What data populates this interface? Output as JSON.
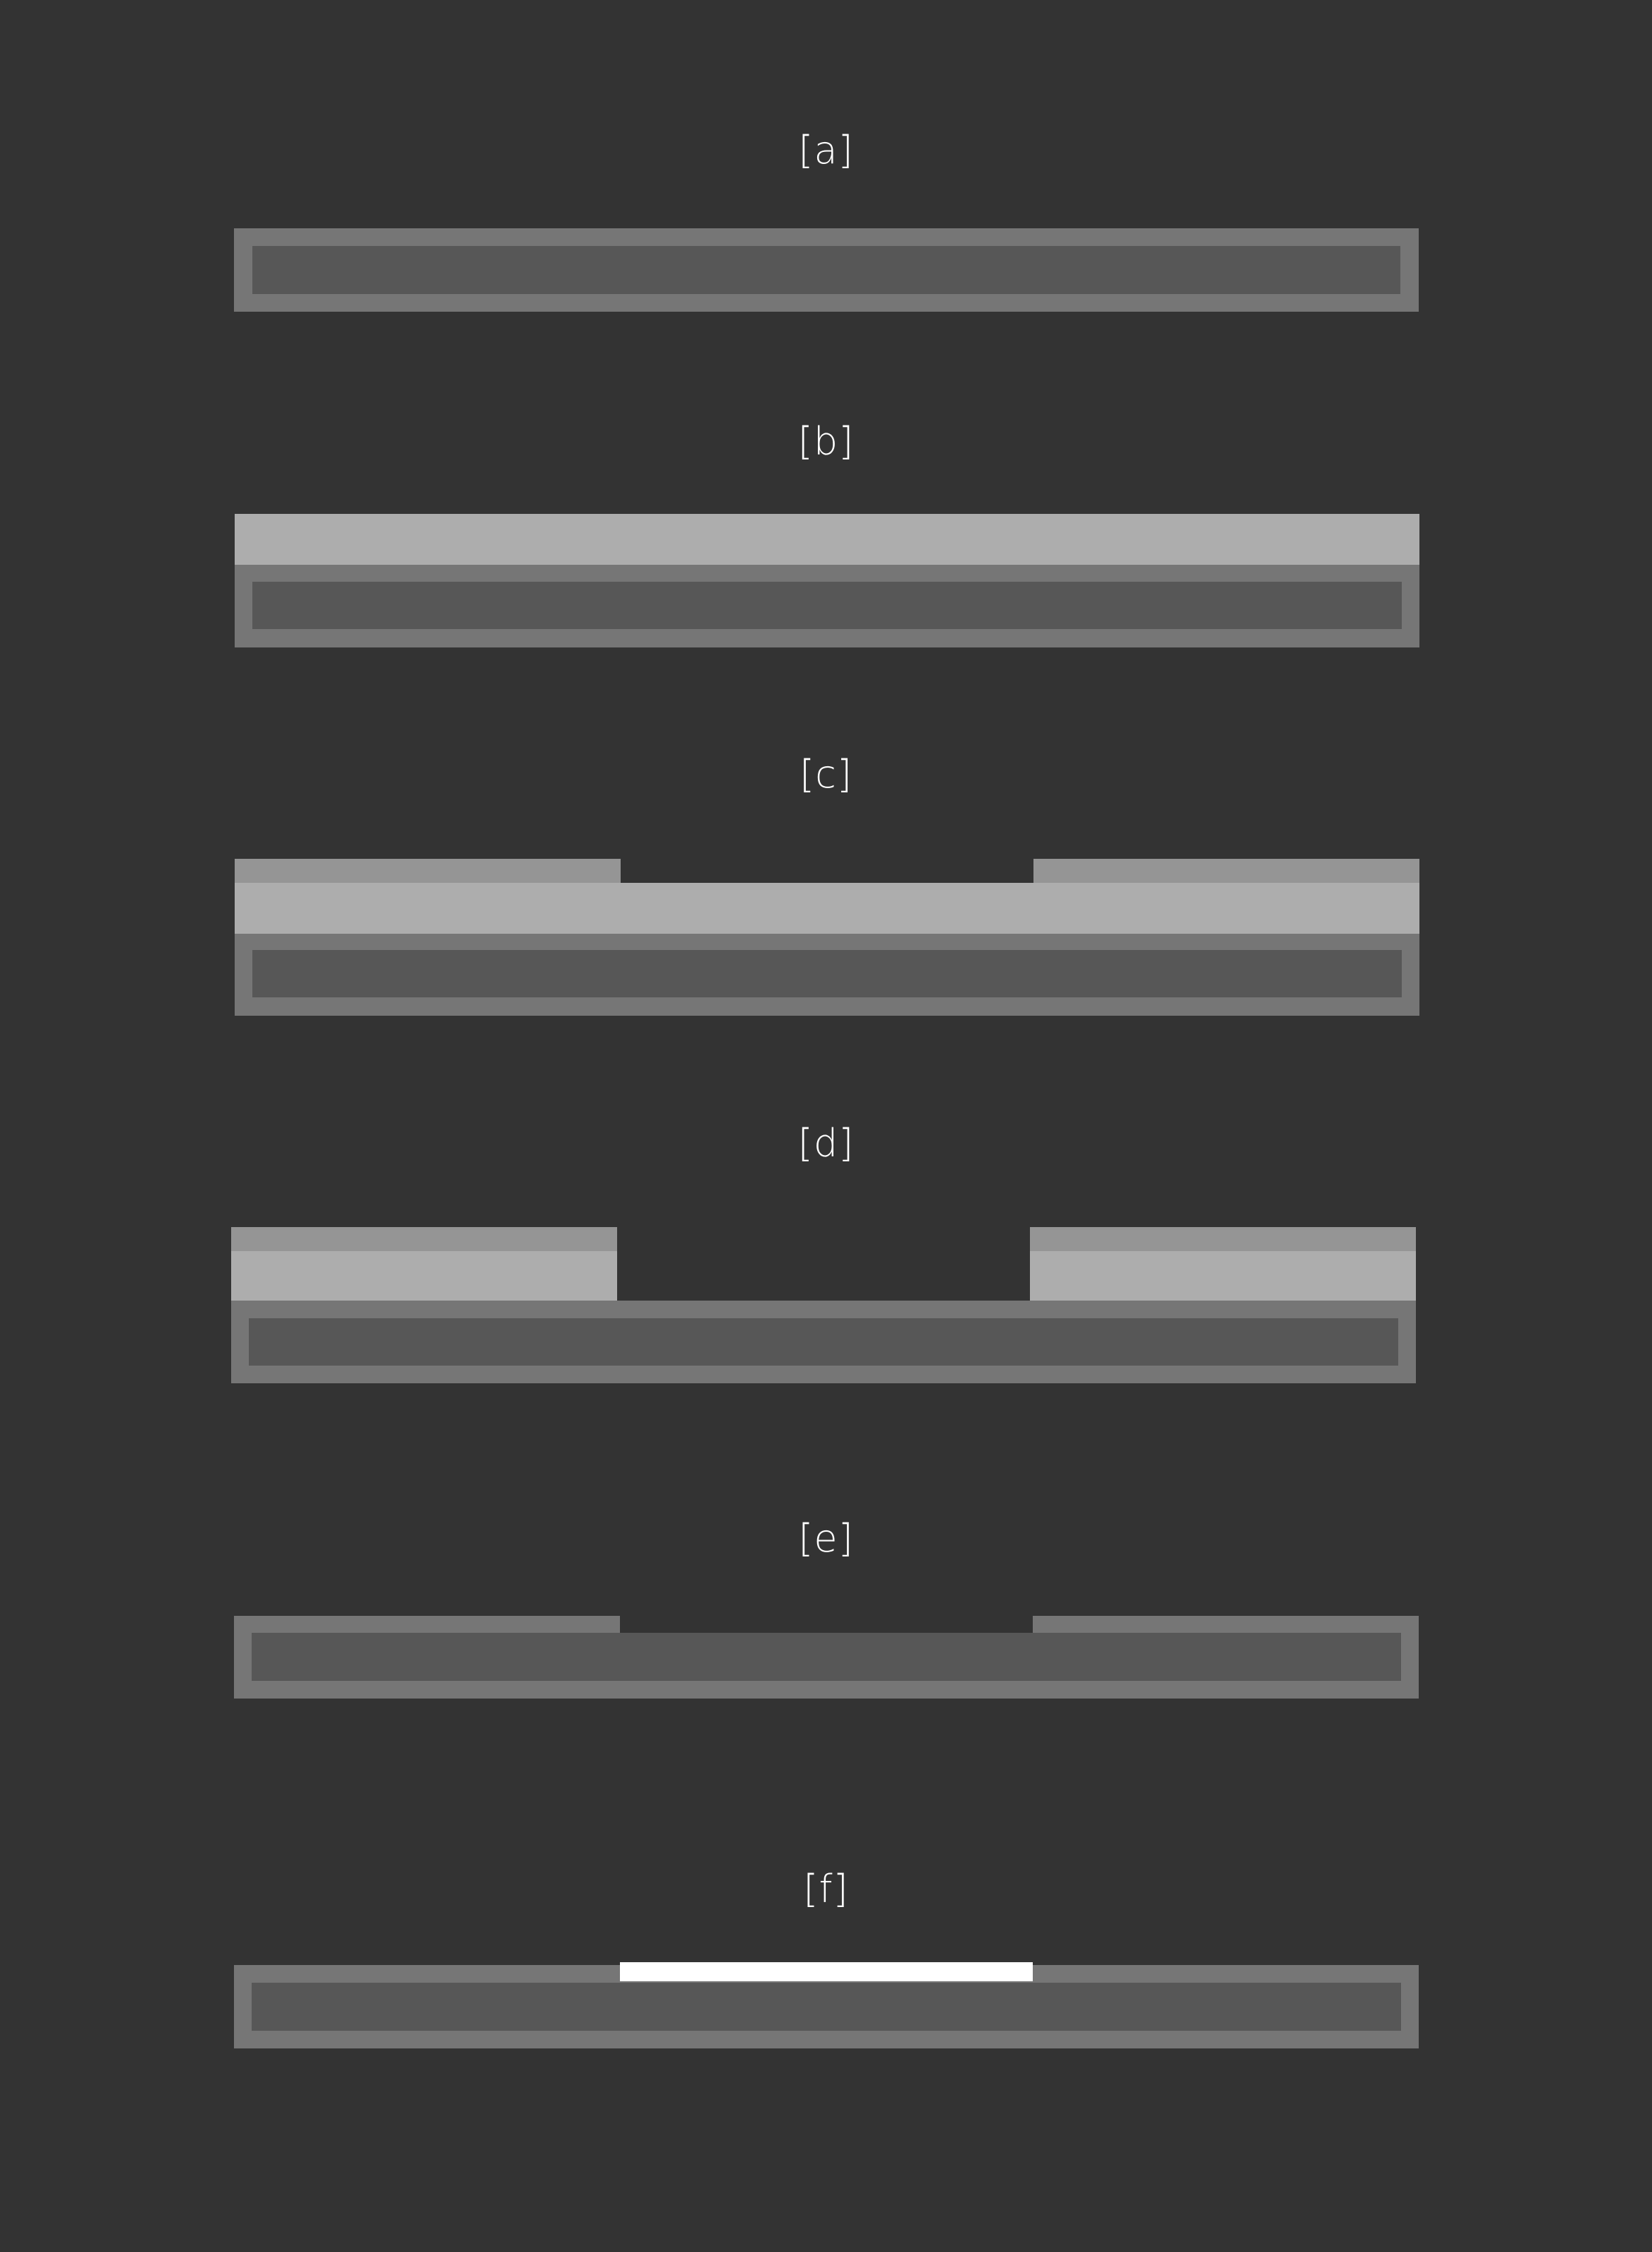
{
  "steps": [
    {
      "id": "a",
      "label": "[a]"
    },
    {
      "id": "b",
      "label": "[b]"
    },
    {
      "id": "c",
      "label": "[c]"
    },
    {
      "id": "d",
      "label": "[d]"
    },
    {
      "id": "e",
      "label": "[e]"
    },
    {
      "id": "f",
      "label": "[f]"
    }
  ],
  "colors": {
    "background": "#333333",
    "substrate_frame": "#767676",
    "substrate_core": "#575757",
    "film": "#adadad",
    "resist": "#959595",
    "deposit": "#ffffff"
  }
}
